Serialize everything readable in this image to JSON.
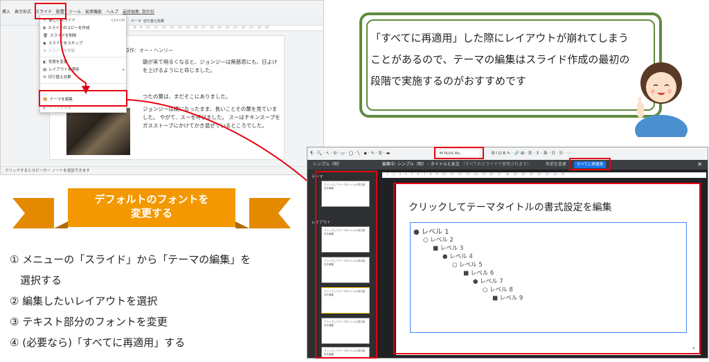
{
  "colors": {
    "accent_red": "#e60012",
    "callout_green": "#5e8b3f",
    "ribbon_orange": "#f39800",
    "apply_blue": "#1a73e8"
  },
  "left_screen": {
    "menu": [
      "挿入",
      "表示形式",
      "スライド",
      "配置",
      "ツール",
      "拡張機能",
      "ヘルプ",
      "最終編集: 数秒前"
    ],
    "toolbar_right": [
      "テーマ",
      "切り替え効果"
    ],
    "dropdown": {
      "new_slide": "新しいスライド",
      "new_slide_shortcut": "Ctrl+M",
      "duplicate": "スライドのコピーを作成",
      "delete": "スライドを削除",
      "skip": "スライドをスキップ",
      "move": "スライドを移動",
      "change_bg": "背景を変更",
      "apply_layout": "レイアウトを適用",
      "transition": "切り替え効果",
      "edit_theme": "テーマを編集",
      "change_theme": "テーマを変更"
    },
    "slide": {
      "byline": "原作：オー・ヘンリー",
      "para1": "朝が来て明るくなると、ジョンジーは無慈悲にも、日よけを上げるようにと命じました。",
      "para2": "つたの葉は、まだそこにありました。",
      "para3": "ジョンジーは横になったまま、長いことその葉を見ていました。 やがて、スーを呼びました。 スーはチキンスープをガスストーブにかけてかき混ぜているところでした。"
    },
    "bottom": "クリックするとスピーカー ノートを追加できます"
  },
  "callout": {
    "text": "「すべてに再適用」した際にレイアウトが崩れてしまうことがあるので、テーマの編集はスライド作成の最初の段階で実施するのがおすすめです"
  },
  "ribbon": {
    "line1": "デフォルトのフォントを",
    "line2": "変更する"
  },
  "steps": [
    "① メニューの「スライド」から「テーマの編集」を",
    "　選択する",
    "② 編集したいレイアウトを選択",
    "③ テキスト部分のフォントを変更",
    "④ (必要なら)「すべてに再適用」する"
  ],
  "right_screen": {
    "font_name": "M PLUS Ro...",
    "panel_title": "シンプル（明）",
    "header_mid": "編集中: シンプル（明） - タイトルと本文",
    "header_dim": "（すべてのスライドで使用されます）",
    "rename": "名前を変更",
    "apply_all": "すべてに再適用",
    "label_theme": "テーマ",
    "label_layout": "レイアウト",
    "thumb_title": "クリックしてテーマタイトルの書式設定を編集",
    "canvas_title": "クリックしてテーマタイトルの書式設定を編集",
    "levels": [
      "● レベル 1",
      "○ レベル 2",
      "■ レベル 3",
      "● レベル 4",
      "○ レベル 5",
      "■ レベル 6",
      "● レベル 7",
      "○ レベル 8",
      "■ レベル 9"
    ],
    "page_no": "#"
  }
}
